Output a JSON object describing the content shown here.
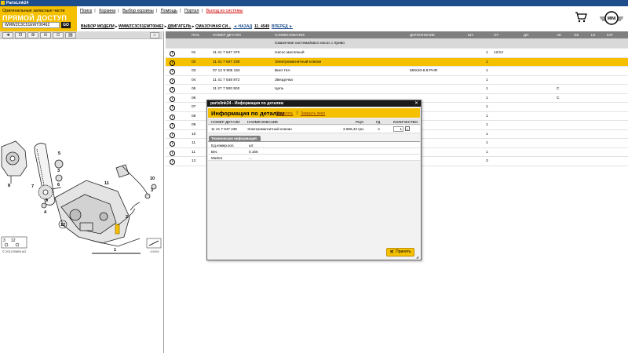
{
  "window": {
    "title": "PartsLink24"
  },
  "brand": {
    "line1": "Оригинальные запасные части",
    "line2": "ПРЯМОЙ ДОСТУП",
    "vin_value": "WMWZC3C51EWT00462",
    "go_label": "GO"
  },
  "topnav": {
    "items": [
      "Поиск",
      "Корзина",
      "Выбор корзины",
      "Помощь",
      "Портал"
    ],
    "exit": "Выход из системы"
  },
  "breadcrumb": {
    "model": "ВЫБОР МОДЕЛИ",
    "vin": "WMWZC3C51EWT00462",
    "group": "ДВИГАТЕЛЬ",
    "subgroup": "СМАЗОЧНАЯ СИ...",
    "back": "◄ НАЗАД",
    "code": "11_4549",
    "forward": "ВПЕРЕД ►"
  },
  "diagram": {
    "callouts": [
      "1",
      "2",
      "3",
      "4",
      "5",
      "6",
      "7",
      "8",
      "9",
      "10",
      "11",
      "12"
    ],
    "thumb_labels": [
      "3",
      "12"
    ],
    "image_code": "405655",
    "copyright": "© 2013 BMW AG"
  },
  "grid": {
    "columns": [
      "ПОЗ.",
      "НОМЕР ДЕТАЛИ",
      "НАИМЕНОВАНИЕ",
      "ДОПОЛНЕНИЕ",
      "ШТ.",
      "ОТ",
      "ДО",
      "АЕ",
      "GE",
      "LE",
      "КАТ"
    ],
    "group_text": "Смазочная система/масл.насос с приво",
    "rows": [
      {
        "pos": "01",
        "part": "11 41 7 647 376",
        "name": "Насос масляный",
        "extra": "",
        "qty": "1",
        "from": "12/12",
        "ae": "",
        "sel": false
      },
      {
        "pos": "02",
        "part": "11 41 7 647 238",
        "name": "Электромагнитный клапан",
        "extra": "",
        "qty": "1",
        "from": "",
        "ae": "",
        "sel": true
      },
      {
        "pos": "03",
        "part": "07 12 9 905 152",
        "name": "Винт ISA",
        "extra": "M6X20-8.8-PHR",
        "qty": "1",
        "from": "",
        "ae": "",
        "sel": false
      },
      {
        "pos": "04",
        "part": "11 41 7 548 872",
        "name": "Звездочка",
        "extra": "",
        "qty": "1",
        "from": "",
        "ae": "",
        "sel": false
      },
      {
        "pos": "05",
        "part": "11 27 7 500 502",
        "name": "Цепь",
        "extra": "",
        "qty": "1",
        "from": "",
        "ae": "C",
        "sel": false
      },
      {
        "pos": "06",
        "part": "",
        "name": "",
        "extra": "",
        "qty": "1",
        "from": "",
        "ae": "C",
        "sel": false
      },
      {
        "pos": "07",
        "part": "",
        "name": "",
        "extra": "",
        "qty": "1",
        "from": "",
        "ae": "",
        "sel": false
      },
      {
        "pos": "08",
        "part": "",
        "name": "",
        "extra": "",
        "qty": "1",
        "from": "",
        "ae": "",
        "sel": false
      },
      {
        "pos": "09",
        "part": "",
        "name": "",
        "extra": "",
        "qty": "1",
        "from": "",
        "ae": "",
        "sel": false
      },
      {
        "pos": "10",
        "part": "",
        "name": "",
        "extra": "",
        "qty": "1",
        "from": "",
        "ae": "",
        "sel": false
      },
      {
        "pos": "11",
        "part": "",
        "name": "",
        "extra": "",
        "qty": "1",
        "from": "",
        "ae": "",
        "sel": false
      },
      {
        "pos": "11",
        "part": "",
        "name": "",
        "extra": "",
        "qty": "1",
        "from": "",
        "ae": "",
        "sel": false
      },
      {
        "pos": "12",
        "part": "",
        "name": "",
        "extra": "",
        "qty": "3",
        "from": "",
        "ae": "",
        "sel": false
      }
    ]
  },
  "modal": {
    "title": "partslink24 - Информация по деталям",
    "heading": "Информация по деталям",
    "print": "Печатать",
    "close_window": "Закрыть окно",
    "columns": [
      "НОМЕР ДЕТАЛИ",
      "НАИМЕНОВАНИЕ",
      "РЦО",
      "ГД",
      "КОЛИЧЕСТВО"
    ],
    "row": {
      "part": "11 41 7 647 238",
      "name": "Электромагнитный клапан",
      "price": "3 666,43 грн.",
      "gd": "A",
      "qty": "1"
    },
    "tech_tab": "Техническая информация",
    "tech": [
      {
        "label": "Ед.измер.кол.",
        "value": "шт."
      },
      {
        "label": "Вес",
        "value": "0.166"
      },
      {
        "label": "Market",
        "value": "..."
      }
    ],
    "apply": "Принять"
  },
  "colors": {
    "accent": "#f5c000",
    "header_gray": "#7f7f7f",
    "titlebar": "#1e4d8c"
  }
}
